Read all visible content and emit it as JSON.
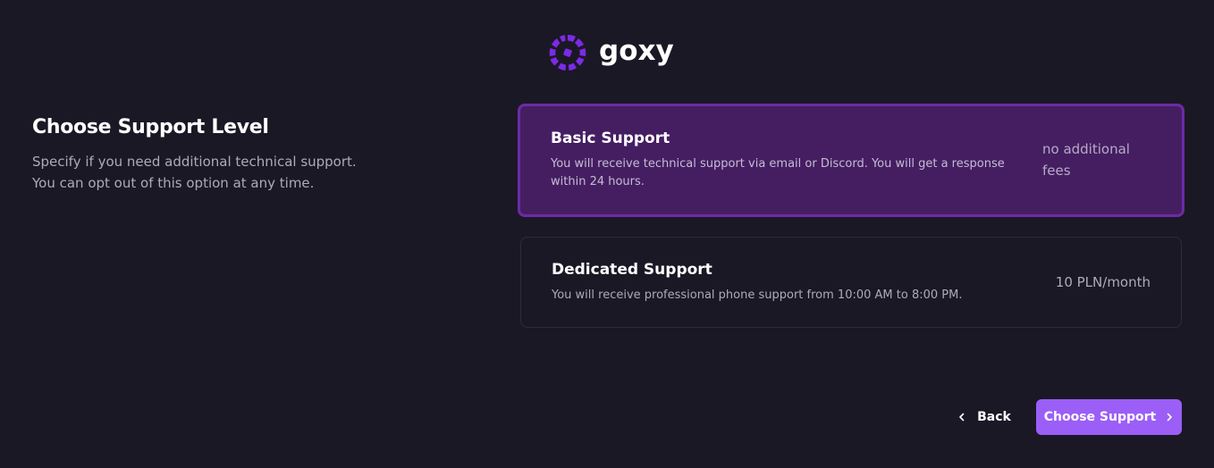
{
  "brand": {
    "name": "goxy",
    "accent_color": "#9b5ef7",
    "logo_color": "#7c2ae8"
  },
  "intro": {
    "title": "Choose Support Level",
    "description_line1": "Specify if you need additional technical support.",
    "description_line2": "You can opt out of this option at any time."
  },
  "options": [
    {
      "title": "Basic Support",
      "description": "You will receive technical support via email or Discord. You will get a response within 24 hours.",
      "price": "no additional fees",
      "selected": true
    },
    {
      "title": "Dedicated Support",
      "description": "You will receive professional phone support from 10:00 AM to 8:00 PM.",
      "price": "10 PLN/month",
      "selected": false
    }
  ],
  "footer": {
    "back_label": "Back",
    "back_icon": "chevron-left-icon",
    "primary_label": "Choose Support",
    "primary_icon": "chevron-right-icon"
  }
}
